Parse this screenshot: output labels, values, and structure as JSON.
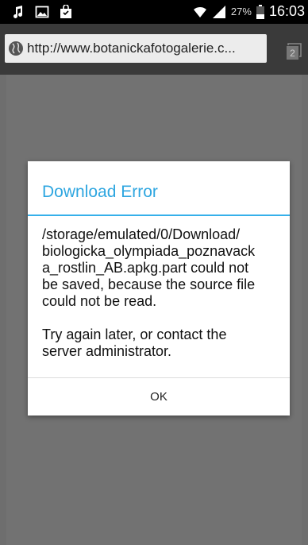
{
  "status_bar": {
    "left_icons": [
      "music-icon",
      "image-icon",
      "shopping-bag-icon"
    ],
    "right_icons": [
      "wifi-icon",
      "signal-icon",
      "battery-icon"
    ],
    "battery_percent": "27%",
    "time": "16:03"
  },
  "browser": {
    "url": "http://www.botanickafotogalerie.c...",
    "tab_count": "2"
  },
  "dialog": {
    "title": "Download Error",
    "message": "/storage/emulated/0/Download/\nbiologicka_olympiada_poznavack\na_rostlin_AB.apkg.part could not\nbe saved, because the source file\ncould not be read.",
    "hint": "Try again later, or contact the\nserver administrator.",
    "ok_label": "OK"
  }
}
